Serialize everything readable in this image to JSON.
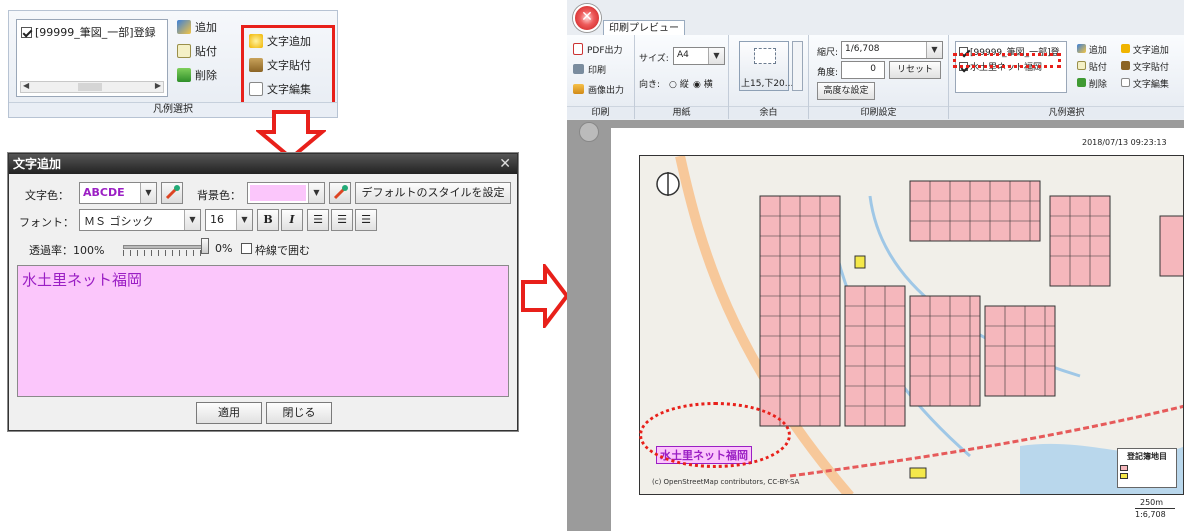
{
  "legend_panel": {
    "item_label": "[99999_筆図_一部]登録",
    "buttons": {
      "add": "追加",
      "paste": "貼付",
      "delete": "削除",
      "text_add": "文字追加",
      "text_paste": "文字貼付",
      "text_edit": "文字編集"
    },
    "footer": "凡例選択"
  },
  "dialog": {
    "title": "文字追加",
    "text_color_label": "文字色：",
    "text_color_sample": "ABCDE",
    "bg_color_label": "背景色：",
    "default_style_button": "デフォルトのスタイルを設定",
    "font_label": "フォント：",
    "font_value": "ＭＳ ゴシック",
    "size_value": "16",
    "bold": "B",
    "italic": "I",
    "opacity_label": "透過率：100%",
    "opacity_min": "0%",
    "border_label": "枠線で囲む",
    "text_content": "水土里ネット福岡",
    "apply_button": "適用",
    "close_button": "閉じる"
  },
  "preview": {
    "tab": "印刷プレビュー",
    "print_group": {
      "pdf": "PDF出力",
      "print": "印刷",
      "image": "画像出力",
      "footer": "印刷"
    },
    "paper_group": {
      "size_label": "サイズ:",
      "size_value": "A4",
      "orient_label": "向き:",
      "portrait": "縦",
      "landscape": "横",
      "footer": "用紙"
    },
    "margin_group": {
      "value": "上15,下20...",
      "footer": "余白"
    },
    "settings_group": {
      "scale_label": "縮尺:",
      "scale_value": "1/6,708",
      "angle_label": "角度:",
      "angle_value": "0",
      "reset_button": "リセット",
      "advanced_button": "高度な設定",
      "footer": "印刷設定"
    },
    "legend_group": {
      "item1": "[99999_筆図_一部]登",
      "item2": "水土里ネット福岡",
      "add": "追加",
      "paste": "貼付",
      "delete": "削除",
      "text_add": "文字追加",
      "text_paste": "文字貼付",
      "text_edit": "文字編集",
      "footer": "凡例選択"
    },
    "timestamp": "2018/07/13 09:23:13",
    "map_label": "水土里ネット福岡",
    "attribution": "(c) OpenStreetMap contributors, CC-BY-SA",
    "legend_title": "登記簿地目",
    "scale_bar": "250m",
    "scale_ratio": "1:6,708"
  }
}
